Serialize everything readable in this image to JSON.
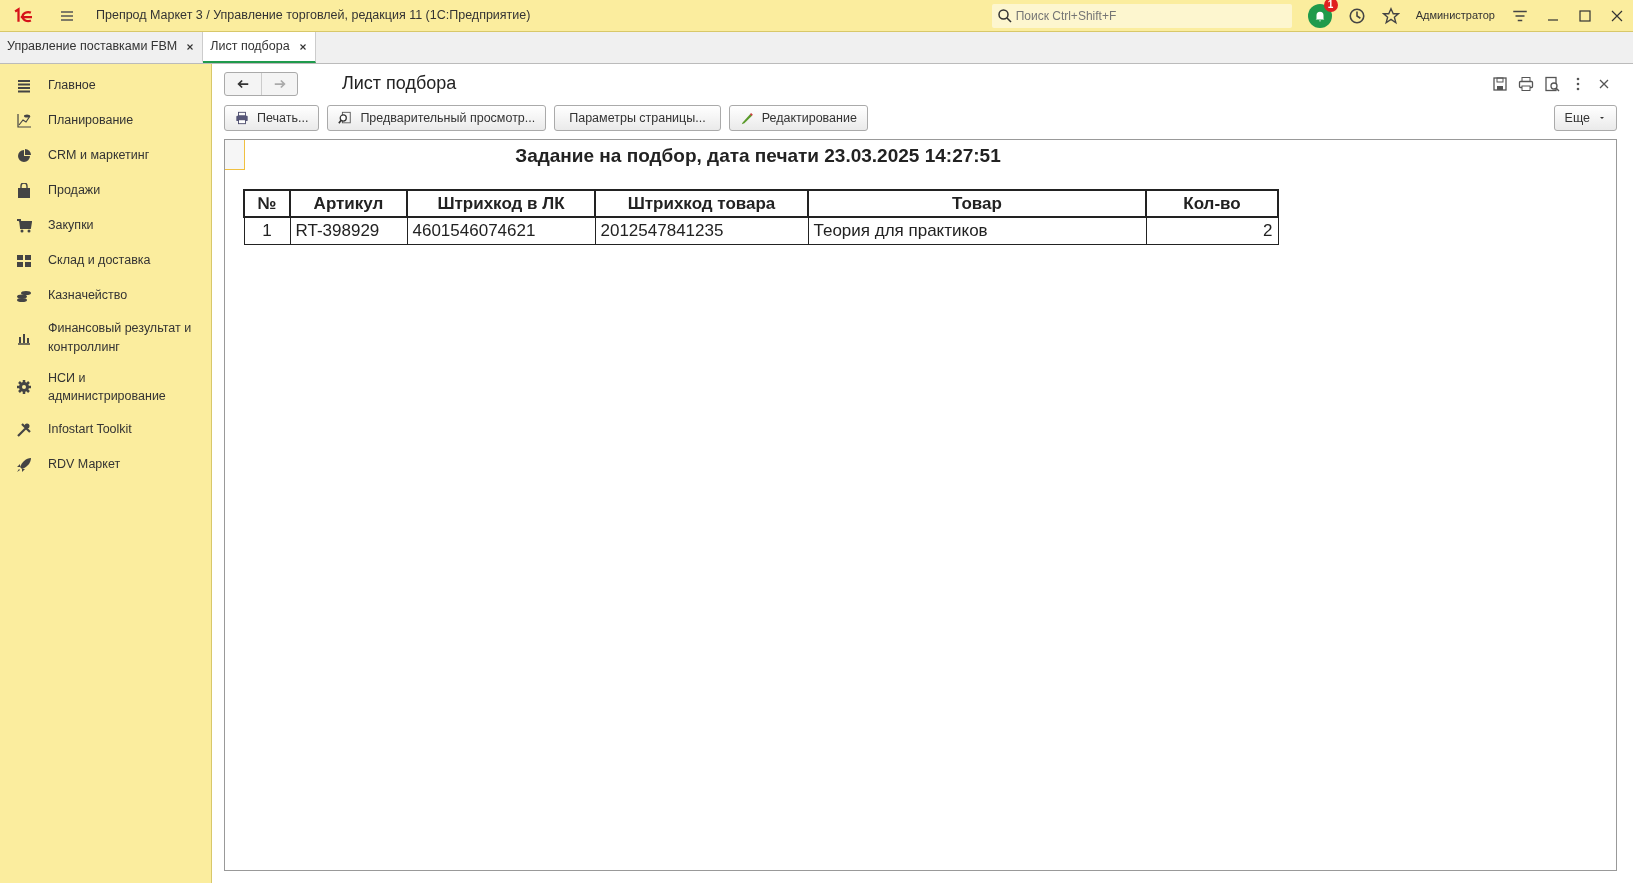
{
  "window": {
    "title": "Препрод Маркет 3 / Управление торговлей, редакция 11  (1С:Предприятие)",
    "search": {
      "placeholder": "Поиск Ctrl+Shift+F"
    },
    "notification_count": "1",
    "user": "Администратор"
  },
  "tabs": [
    {
      "label": "Управление поставками FBM",
      "selected": false
    },
    {
      "label": "Лист подбора",
      "selected": true
    }
  ],
  "sidebar": {
    "items": [
      {
        "label": "Главное",
        "kind": "list"
      },
      {
        "label": "Планирование",
        "kind": "chart"
      },
      {
        "label": "CRM и маркетинг",
        "kind": "pie"
      },
      {
        "label": "Продажи",
        "kind": "bag"
      },
      {
        "label": "Закупки",
        "kind": "cart"
      },
      {
        "label": "Склад и доставка",
        "kind": "grid"
      },
      {
        "label": "Казначейство",
        "kind": "coins"
      },
      {
        "label": "Финансовый результат и контроллинг",
        "kind": "bars"
      },
      {
        "label": "НСИ и администрирование",
        "kind": "gear"
      },
      {
        "label": "Infostart Toolkit",
        "kind": "tools"
      },
      {
        "label": "RDV Маркет",
        "kind": "rocket"
      }
    ]
  },
  "form": {
    "title": "Лист подбора",
    "navigation": {
      "back_disabled": false,
      "forward_disabled": true
    },
    "buttons": [
      {
        "label": "Печать...",
        "kind": "print"
      },
      {
        "label": "Предварительный просмотр...",
        "kind": "preview"
      },
      {
        "label": "Параметры страницы...",
        "kind": "none"
      },
      {
        "label": "Редактирование",
        "kind": "pencil"
      }
    ],
    "more_button": "Еще",
    "report": {
      "heading": "Задание на подбор, дата печати 23.03.2025 14:27:51",
      "columns": [
        "№",
        "Артикул",
        "Штрихкод в ЛК",
        "Штрихкод товара",
        "Товар",
        "Кол-во"
      ],
      "rows": [
        [
          "1",
          "RT-398929",
          "4601546074621",
          "2012547841235",
          "Теория для практиков",
          "2"
        ]
      ]
    }
  }
}
